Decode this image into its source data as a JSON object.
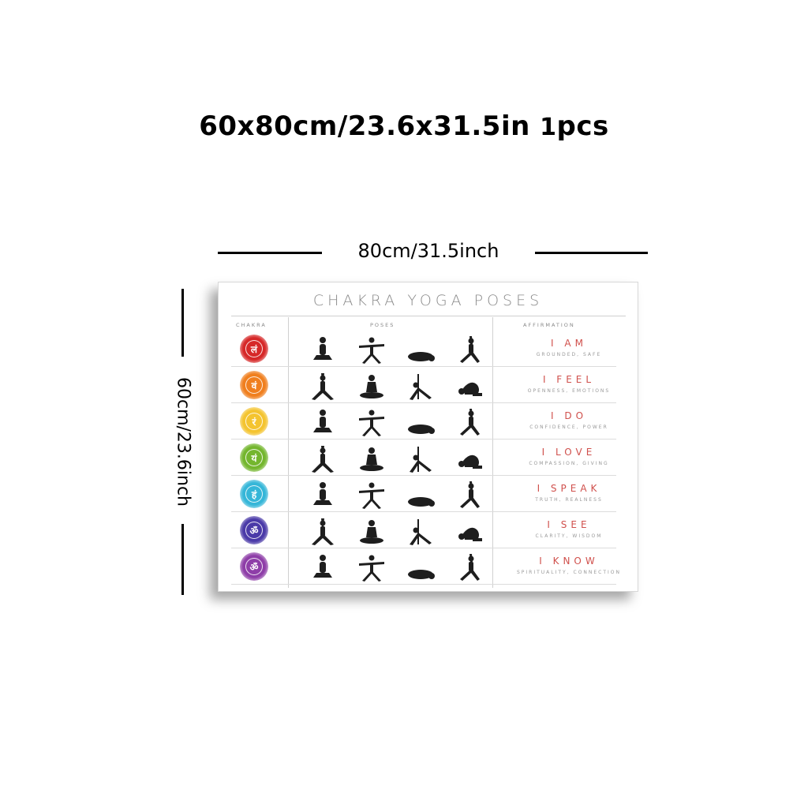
{
  "headline": {
    "size_text": "60x80cm/23.6x31.5in",
    "qty_number": "1",
    "qty_unit": "pcs"
  },
  "width_label": "80cm/31.5inch",
  "height_label": "60cm/23.6inch",
  "poster": {
    "title": "CHAKRA YOGA POSES",
    "columns": [
      "CHAKRA",
      "POSES",
      "AFFIRMATION"
    ],
    "rows": [
      {
        "color": "#d62828",
        "symbol": "लं",
        "affirmation": "I AM",
        "theme": "GROUNDED, SAFE"
      },
      {
        "color": "#f07f1e",
        "symbol": "वं",
        "affirmation": "I FEEL",
        "theme": "OPENNESS, EMOTIONS"
      },
      {
        "color": "#f4c430",
        "symbol": "रं",
        "affirmation": "I DO",
        "theme": "CONFIDENCE, POWER"
      },
      {
        "color": "#74b62e",
        "symbol": "यं",
        "affirmation": "I LOVE",
        "theme": "COMPASSION, GIVING"
      },
      {
        "color": "#35b6d8",
        "symbol": "हं",
        "affirmation": "I SPEAK",
        "theme": "TRUTH, REALNESS"
      },
      {
        "color": "#4a3aa8",
        "symbol": "ॐ",
        "affirmation": "I SEE",
        "theme": "CLARITY, WISDOM"
      },
      {
        "color": "#8e3ea8",
        "symbol": "ॐ",
        "affirmation": "I KNOW",
        "theme": "SPIRITUALITY, CONNECTION"
      }
    ],
    "pose_icons": [
      [
        "seated-pose-icon",
        "warrior-pose-icon",
        "childs-pose-icon",
        "crescent-lunge-icon"
      ],
      [
        "lunge-arms-up-icon",
        "lotus-pose-icon",
        "triangle-pose-icon",
        "forward-fold-icon"
      ],
      [
        "boat-pose-icon",
        "side-plank-icon",
        "bow-pose-icon",
        "downward-dog-icon"
      ],
      [
        "wheel-pose-icon",
        "cobra-pose-icon",
        "pigeon-pose-icon",
        "camel-pose-icon"
      ],
      [
        "plow-pose-icon",
        "sphinx-pose-icon",
        "dolphin-pose-icon",
        "upward-dog-icon"
      ],
      [
        "childs-pose-icon",
        "downward-dog-icon",
        "tree-pose-icon",
        "meditation-pose-icon"
      ],
      [
        "headstand-icon",
        "meditation-pose-icon",
        "mountain-pose-icon",
        "cobra-pose-icon"
      ]
    ]
  }
}
